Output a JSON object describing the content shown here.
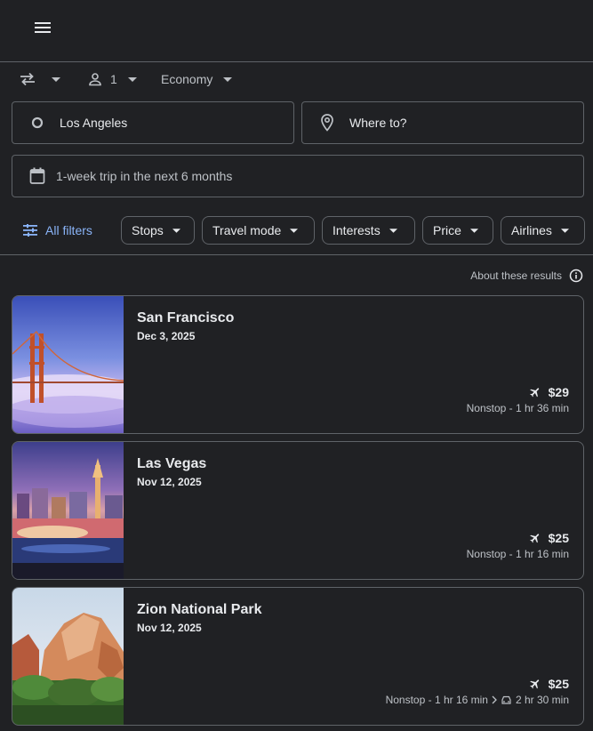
{
  "header": {
    "menu_icon": "menu-icon"
  },
  "options": {
    "trip_type_icon": "swap-arrows-icon",
    "passengers": "1",
    "cabin_class": "Economy"
  },
  "search": {
    "origin": "Los Angeles",
    "destination_placeholder": "Where to?",
    "dates": "1-week trip in the next 6 months"
  },
  "filters": {
    "all_filters_label": "All filters",
    "chips": [
      "Stops",
      "Travel mode",
      "Interests",
      "Price",
      "Airlines"
    ]
  },
  "about_results": "About these results",
  "results": [
    {
      "name": "San Francisco",
      "date": "Dec 3, 2025",
      "price": "$29",
      "flight_info": "Nonstop - 1 hr 36 min"
    },
    {
      "name": "Las Vegas",
      "date": "Nov 12, 2025",
      "price": "$25",
      "flight_info": "Nonstop - 1 hr 16 min"
    },
    {
      "name": "Zion National Park",
      "date": "Nov 12, 2025",
      "price": "$25",
      "flight_info": "Nonstop - 1 hr 16 min",
      "drive_info": "2 hr 30 min"
    }
  ],
  "colors": {
    "background": "#202124",
    "border": "#5f6368",
    "accent": "#8ab4f8",
    "text": "#e8eaed",
    "muted": "#bdc1c6"
  }
}
